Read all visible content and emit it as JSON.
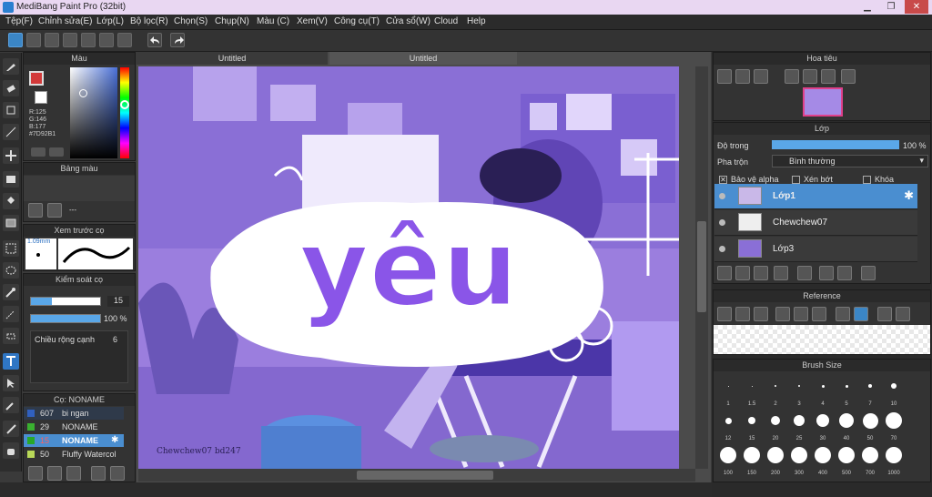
{
  "window": {
    "title": "MediBang Paint Pro (32bit)",
    "minimize": "▁",
    "maximize": "❐",
    "close": "✕"
  },
  "menu": [
    "Tệp(F)",
    "Chỉnh sửa(E)",
    "Lớp(L)",
    "Bộ lọc(R)",
    "Chọn(S)",
    "Chụp(N)",
    "Màu (C)",
    "Xem(V)",
    "Công cụ(T)",
    "Cửa sổ(W)",
    "Cloud",
    "Help"
  ],
  "tabs": [
    "Untitled",
    "Untitled"
  ],
  "color_panel": {
    "title": "Màu",
    "r": "R:125",
    "g": "G:146",
    "b": "B:177",
    "hex": "#7D92B1"
  },
  "palette_panel": {
    "title": "Bảng màu",
    "dash": "---"
  },
  "brush_preview": {
    "title": "Xem trước cọ",
    "size": "1.09mm"
  },
  "brush_control": {
    "title": "Kiểm soát cọ",
    "size_value": "15",
    "opacity_value": "100 %",
    "width_label": "Chiều rộng cạnh",
    "width_value": "6"
  },
  "brush_list": {
    "title": "Cọ: NONAME",
    "items": [
      {
        "size": "607",
        "name": "bi ngan",
        "color": "#3060c0"
      },
      {
        "size": "29",
        "name": "NONAME",
        "color": "#3ab030"
      },
      {
        "size": "15",
        "name": "NONAME",
        "color": "#28a828"
      },
      {
        "size": "50",
        "name": "Fluffy Watercol",
        "color": "#b8d858"
      }
    ]
  },
  "navigator": {
    "title": "Hoa tiêu"
  },
  "layer_panel": {
    "title": "Lớp",
    "opacity_label": "Độ trong",
    "opacity_value": "100 %",
    "blend_label": "Pha trộn",
    "blend_value": "Bình thường",
    "protect_alpha": "Bảo vệ alpha",
    "clip": "Xén bớt",
    "lock": "Khóa",
    "layers": [
      {
        "name": "Lớp1",
        "selected": true
      },
      {
        "name": "Chewchew07",
        "selected": false
      },
      {
        "name": "Lớp3",
        "selected": false
      }
    ]
  },
  "reference": {
    "title": "Reference"
  },
  "brush_size": {
    "title": "Brush Size",
    "sizes": [
      "1",
      "1.5",
      "2",
      "3",
      "4",
      "5",
      "7",
      "10",
      "12",
      "15",
      "20",
      "25",
      "30",
      "40",
      "50",
      "70",
      "100",
      "150",
      "200",
      "300",
      "400",
      "500",
      "700",
      "1000"
    ]
  },
  "artwork": {
    "main_text": "yêu",
    "signature": "Chewchew07 bd247"
  },
  "colors": {
    "accent": "#4a8ed0",
    "canvas_purple": "#9f7fe0"
  }
}
